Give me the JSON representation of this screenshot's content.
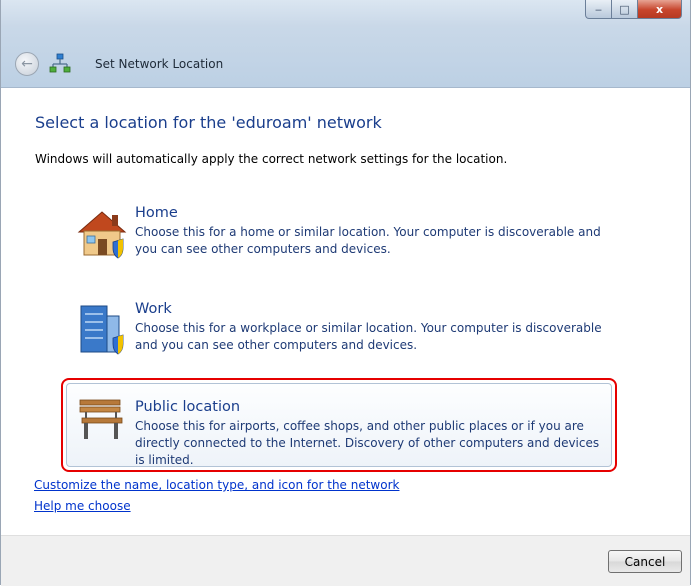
{
  "window": {
    "title": "Set Network Location",
    "controls": {
      "minimize_icon": "minimize-icon",
      "maximize_icon": "maximize-icon",
      "close_label": "x"
    }
  },
  "nav": {
    "back_icon": "back-arrow-icon",
    "network_icon": "network-icon"
  },
  "content": {
    "heading": "Select a location for the 'eduroam' network",
    "intro": "Windows will automatically apply the correct network settings for the location."
  },
  "options": [
    {
      "title": "Home",
      "icon": "home-icon",
      "description": "Choose this for a home or similar location. Your computer is discoverable and you can see other computers and devices."
    },
    {
      "title": "Work",
      "icon": "work-building-icon",
      "description": "Choose this for a workplace or similar location. Your computer is discoverable and you can see other computers and devices."
    },
    {
      "title": "Public location",
      "icon": "park-bench-icon",
      "description": "Choose this for airports, coffee shops, and other public places or if you are directly connected to the Internet. Discovery of other computers and devices is limited.",
      "highlight_color": "#e60000"
    }
  ],
  "links": {
    "customize": "Customize the name, location type, and icon for the network",
    "help": "Help me choose"
  },
  "footer": {
    "cancel_label": "Cancel"
  },
  "colors": {
    "heading": "#1a3e8c",
    "link": "#0033cc",
    "highlight": "#e60000"
  }
}
